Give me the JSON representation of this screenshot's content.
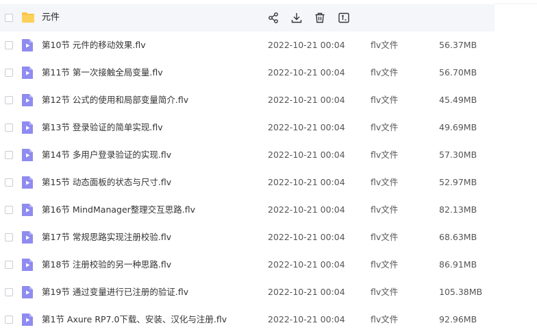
{
  "colors": {
    "folder": "#f8c44a",
    "file_icon": "#8f8bf0",
    "header_bg": "#f4f6f9"
  },
  "folder": {
    "name": "元件",
    "icon": "folder-icon"
  },
  "toolbar": [
    "share-icon",
    "download-icon",
    "delete-icon",
    "rename-icon"
  ],
  "files": [
    {
      "name": "第10节  元件的移动效果.flv",
      "date": "2022-10-21 00:04",
      "type": "flv文件",
      "size": "56.37MB"
    },
    {
      "name": "第11节  第一次接触全局变量.flv",
      "date": "2022-10-21 00:04",
      "type": "flv文件",
      "size": "56.70MB"
    },
    {
      "name": "第12节  公式的使用和局部变量简介.flv",
      "date": "2022-10-21 00:04",
      "type": "flv文件",
      "size": "45.49MB"
    },
    {
      "name": "第13节  登录验证的简单实现.flv",
      "date": "2022-10-21 00:04",
      "type": "flv文件",
      "size": "49.69MB"
    },
    {
      "name": "第14节  多用户登录验证的实现.flv",
      "date": "2022-10-21 00:04",
      "type": "flv文件",
      "size": "57.30MB"
    },
    {
      "name": "第15节  动态面板的状态与尺寸.flv",
      "date": "2022-10-21 00:04",
      "type": "flv文件",
      "size": "52.97MB"
    },
    {
      "name": "第16节  MindManager整理交互思路.flv",
      "date": "2022-10-21 00:04",
      "type": "flv文件",
      "size": "82.13MB"
    },
    {
      "name": "第17节  常规思路实现注册校验.flv",
      "date": "2022-10-21 00:04",
      "type": "flv文件",
      "size": "68.63MB"
    },
    {
      "name": "第18节  注册校验的另一种思路.flv",
      "date": "2022-10-21 00:04",
      "type": "flv文件",
      "size": "86.91MB"
    },
    {
      "name": "第19节  通过变量进行已注册的验证.flv",
      "date": "2022-10-21 00:04",
      "type": "flv文件",
      "size": "105.38MB"
    },
    {
      "name": "第1节  Axure RP7.0下载、安装、汉化与注册.flv",
      "date": "2022-10-21 00:04",
      "type": "flv文件",
      "size": "92.96MB"
    }
  ]
}
